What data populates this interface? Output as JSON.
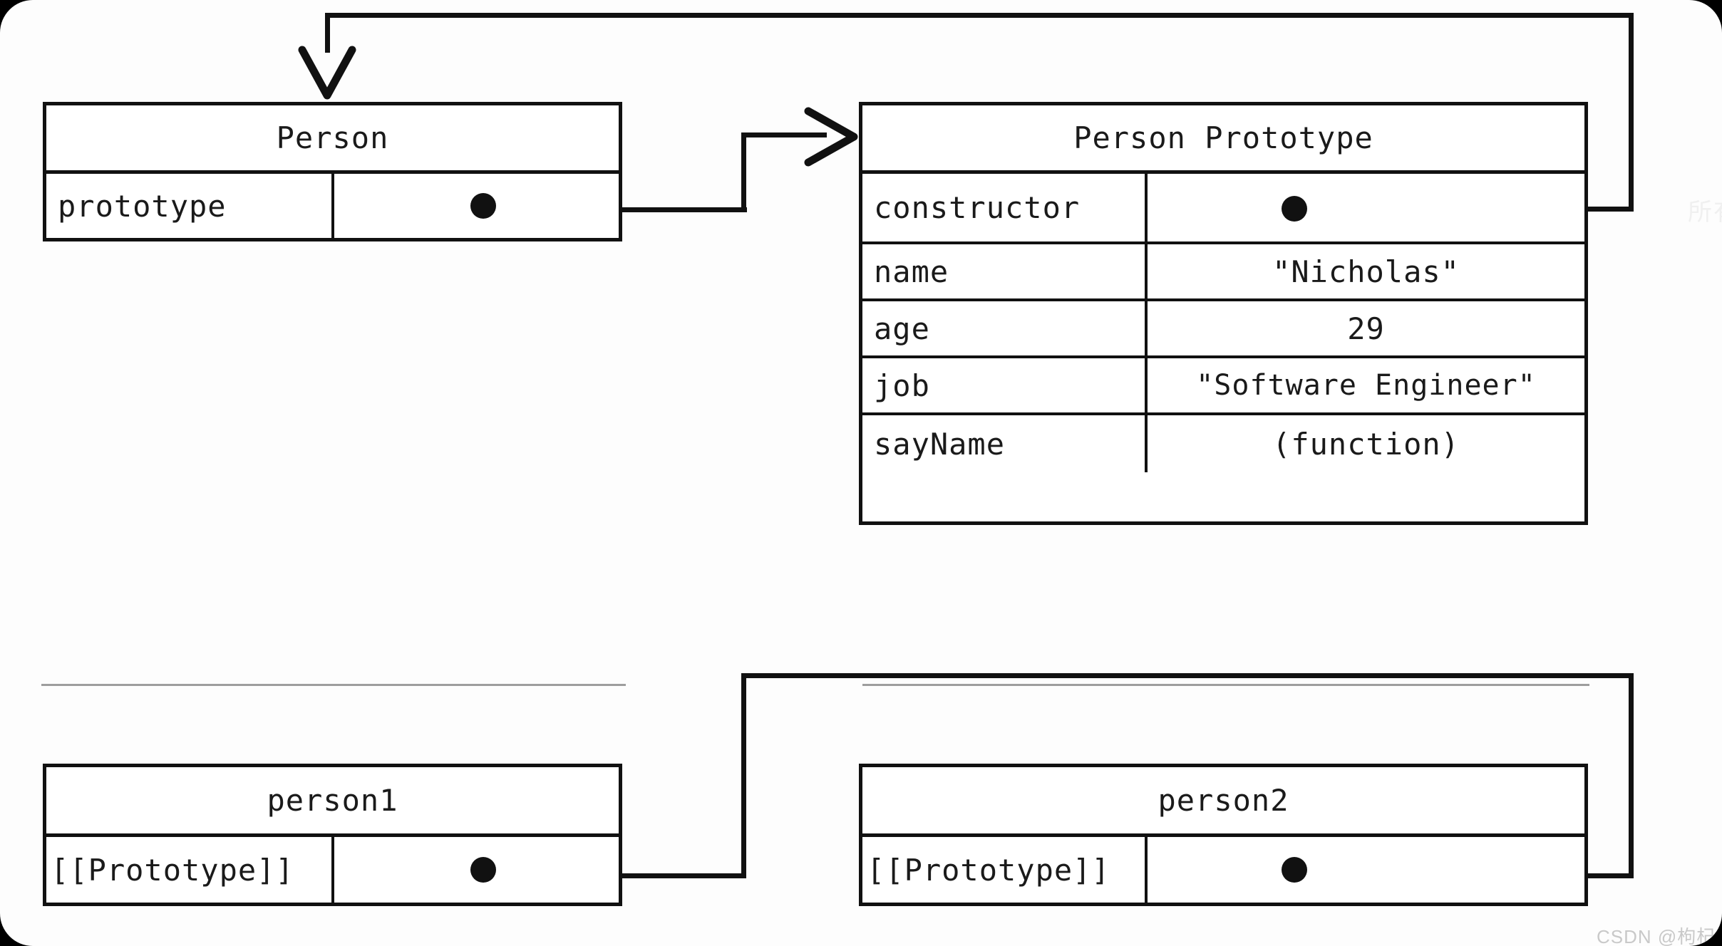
{
  "diagram": {
    "type": "javascript-prototype-chain",
    "colors": {
      "stroke": "#111111",
      "background": "#fdfdfd",
      "box_fill": "#ffffff",
      "text": "#1a1a1a",
      "watermark": "#c9c9c9",
      "faint_watermark": "#f0f0f0",
      "thin_separator": "#8d8d8d"
    },
    "boxes": [
      {
        "id": "person",
        "title": "Person",
        "rows": [
          {
            "key": "prototype",
            "value": "",
            "value_kind": "pointer-dot"
          }
        ]
      },
      {
        "id": "person-prototype",
        "title": "Person Prototype",
        "rows": [
          {
            "key": "constructor",
            "value": "",
            "value_kind": "pointer-dot"
          },
          {
            "key": "name",
            "value": "\"Nicholas\"",
            "value_kind": "text"
          },
          {
            "key": "age",
            "value": "29",
            "value_kind": "text"
          },
          {
            "key": "job",
            "value": "\"Software Engineer\"",
            "value_kind": "text"
          },
          {
            "key": "sayName",
            "value": "(function)",
            "value_kind": "text"
          }
        ]
      },
      {
        "id": "person1",
        "title": "person1",
        "rows": [
          {
            "key": "[[Prototype]]",
            "value": "",
            "value_kind": "pointer-dot"
          }
        ]
      },
      {
        "id": "person2",
        "title": "person2",
        "rows": [
          {
            "key": "[[Prototype]]",
            "value": "",
            "value_kind": "pointer-dot"
          }
        ]
      }
    ],
    "connectors": [
      {
        "id": "person-prototype-to-prototype-object",
        "from": "person.prototype",
        "to": "person-prototype",
        "arrowhead": "open-right"
      },
      {
        "id": "constructor-to-person",
        "from": "person-prototype.constructor",
        "to": "person",
        "arrowhead": "solid-down"
      },
      {
        "id": "person1-prototype-link",
        "from": "person1.[[Prototype]]",
        "to": "person-prototype",
        "arrowhead": "none"
      },
      {
        "id": "person2-prototype-link",
        "from": "person2.[[Prototype]]",
        "to": "person-prototype",
        "arrowhead": "none"
      }
    ]
  },
  "watermarks": {
    "corner": "CSDN @枸杞加上",
    "faint_right": "所有"
  }
}
